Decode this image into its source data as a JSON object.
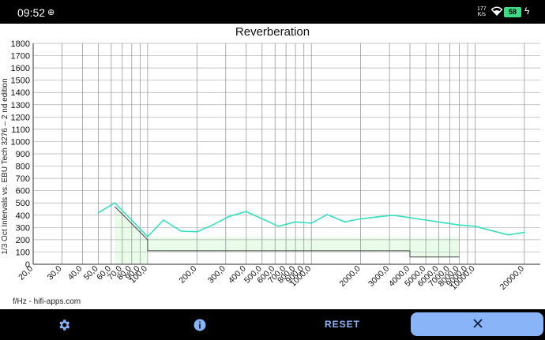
{
  "status": {
    "time": "09:52",
    "net_speed_value": "177",
    "net_speed_unit": "K/s",
    "battery": "58"
  },
  "chart_data": {
    "type": "line",
    "title": "Reverberation",
    "ylabel": "1/3 Oct Intervals vs. EBU Tech 3276 – 2 nd edition",
    "xscale": "log",
    "xlim": [
      20,
      25000
    ],
    "ylim": [
      0,
      1800
    ],
    "y_ticks": [
      0,
      100,
      200,
      300,
      400,
      500,
      600,
      700,
      800,
      900,
      1000,
      1100,
      1200,
      1300,
      1400,
      1500,
      1600,
      1700,
      1800
    ],
    "x_tick_labels": [
      "20,0",
      "30,0",
      "40,0",
      "50,0",
      "60,0",
      "70,0",
      "80,0",
      "90,0",
      "100,0",
      "200,0",
      "300,0",
      "400,0",
      "500,0",
      "600,0",
      "700,0",
      "800,0",
      "900,0",
      "1000,0",
      "2000,0",
      "3000,0",
      "4000,0",
      "5000,0",
      "6000,0",
      "7000,0",
      "8000,0",
      "9000,0",
      "10000,0",
      "20000,0"
    ],
    "x_gridlines": [
      20,
      30,
      40,
      50,
      60,
      70,
      80,
      90,
      100,
      200,
      300,
      400,
      500,
      600,
      700,
      800,
      900,
      1000,
      2000,
      3000,
      4000,
      5000,
      6000,
      7000,
      8000,
      9000,
      10000,
      20000
    ],
    "series": [
      {
        "color": "#34e0c0",
        "x": [
          50,
          63,
          80,
          100,
          125,
          160,
          200,
          250,
          315,
          400,
          500,
          630,
          800,
          1000,
          1250,
          1600,
          2000,
          2500,
          3150,
          4000,
          5000,
          6300,
          8000,
          10000,
          12500,
          16000,
          20000
        ],
        "y": [
          420,
          500,
          360,
          225,
          360,
          270,
          265,
          320,
          390,
          430,
          370,
          310,
          345,
          335,
          405,
          345,
          370,
          385,
          400,
          380,
          360,
          340,
          320,
          310,
          275,
          240,
          260
        ]
      }
    ],
    "tolerance_band": {
      "fill": "#e9fbe9",
      "x": [
        63,
        63,
        100,
        100,
        4000,
        4000,
        8000,
        8000,
        8000,
        8000,
        4000,
        4000,
        100,
        100,
        63
      ],
      "y": [
        0,
        480,
        220,
        220,
        220,
        220,
        220,
        220,
        60,
        60,
        60,
        100,
        100,
        0,
        0
      ]
    },
    "reference_line": {
      "color": "#444444",
      "x": [
        63,
        100,
        100,
        4000,
        4000,
        8000
      ],
      "y": [
        470,
        200,
        110,
        110,
        60,
        60
      ]
    }
  },
  "footer": "f/Hz - hifi-apps.com",
  "bottom_bar": {
    "reset_label": "RESET"
  }
}
